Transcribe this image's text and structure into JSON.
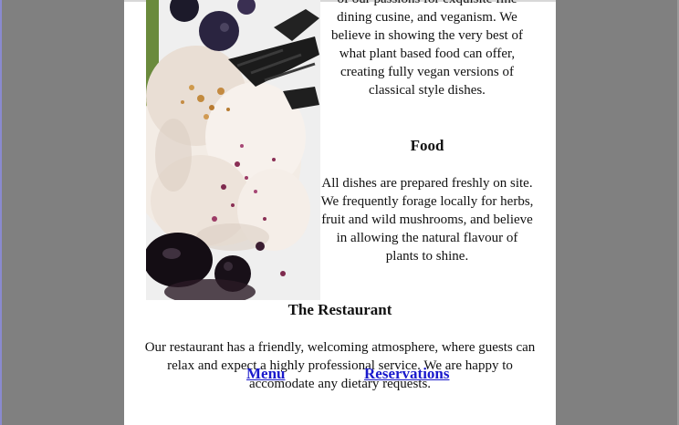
{
  "about": {
    "text": "of our passions for exquisite fine dining cusine, and veganism. We believe in showing the very best of what plant based food can offer, creating fully vegan versions of classical style dishes."
  },
  "food": {
    "heading": "Food",
    "text": "All dishes are prepared freshly on site. We frequently forage locally for herbs, fruit and wild mushrooms, and believe in allowing the natural flavour of plants to shine."
  },
  "restaurant": {
    "heading": "The Restaurant",
    "text": "Our restaurant has a friendly, welcoming atmosphere, where guests can relax and expect a highly professional service. We are happy to accomodate any dietary requests."
  },
  "nav": {
    "menu_label": "Menu",
    "reservations_label": "Reservations"
  },
  "colors": {
    "background": "#808080",
    "page": "#ffffff",
    "link": "#1a1acc"
  }
}
